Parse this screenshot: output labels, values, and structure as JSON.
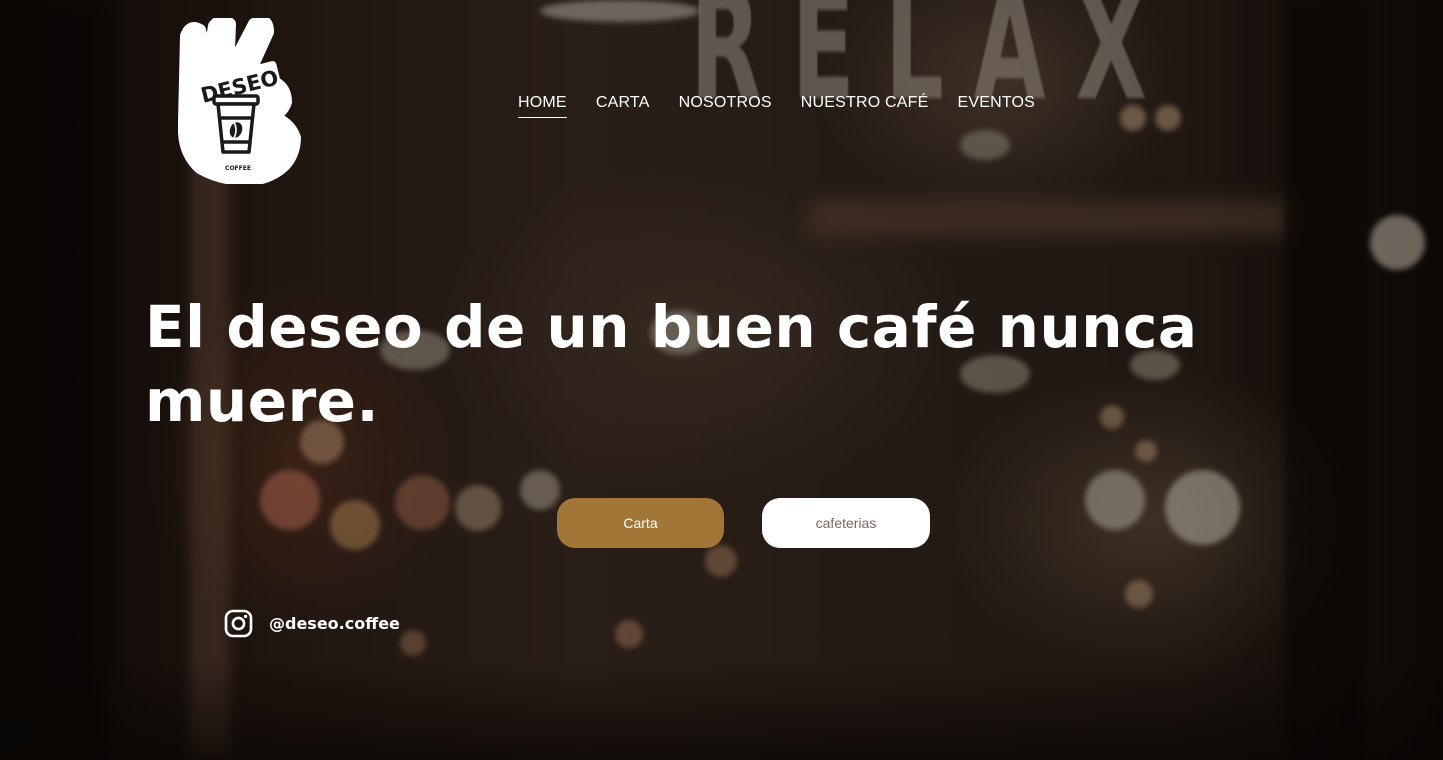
{
  "brand": {
    "logo_word": "DESEO",
    "logo_sub": "COFFEE",
    "backdrop_sign": "RELAX"
  },
  "nav": {
    "items": [
      {
        "label": "HOME",
        "active": true
      },
      {
        "label": "CARTA",
        "active": false
      },
      {
        "label": "NOSOTROS",
        "active": false
      },
      {
        "label": "NUESTRO CAFÉ",
        "active": false
      },
      {
        "label": "EVENTOS",
        "active": false
      }
    ]
  },
  "hero": {
    "headline": "El deseo de un buen café nunca muere."
  },
  "buttons": {
    "carta": "Carta",
    "cafeterias": "cafeterias"
  },
  "social": {
    "icon": "instagram-icon",
    "handle": "@deseo.coffee"
  },
  "colors": {
    "accent": "#a27636",
    "text": "#ffffff",
    "secondary_button_text": "#7a6a5e"
  }
}
